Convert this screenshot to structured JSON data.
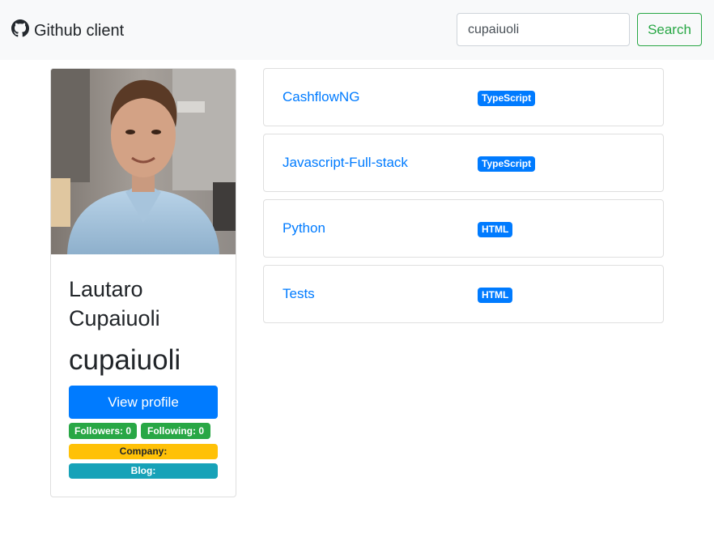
{
  "navbar": {
    "brand_icon": "github-icon",
    "brand_label": "Github client",
    "search": {
      "value": "cupaiuoli",
      "placeholder": "",
      "button_label": "Search"
    }
  },
  "profile": {
    "avatar": "profile-photo",
    "name": "Lautaro Cupaiuoli",
    "login": "cupaiuoli",
    "view_profile_label": "View profile",
    "followers_label": "Followers: 0",
    "following_label": "Following: 0",
    "company_label": "Company:",
    "blog_label": "Blog:"
  },
  "repos": [
    {
      "name": "CashflowNG",
      "language": "TypeScript"
    },
    {
      "name": "Javascript-Full-stack",
      "language": "TypeScript"
    },
    {
      "name": "Python",
      "language": "HTML"
    },
    {
      "name": "Tests",
      "language": "HTML"
    }
  ],
  "colors": {
    "primary": "#007bff",
    "success": "#28a745",
    "warning": "#ffc107",
    "info": "#17a2b8",
    "navbar_bg": "#f8f9fa"
  }
}
